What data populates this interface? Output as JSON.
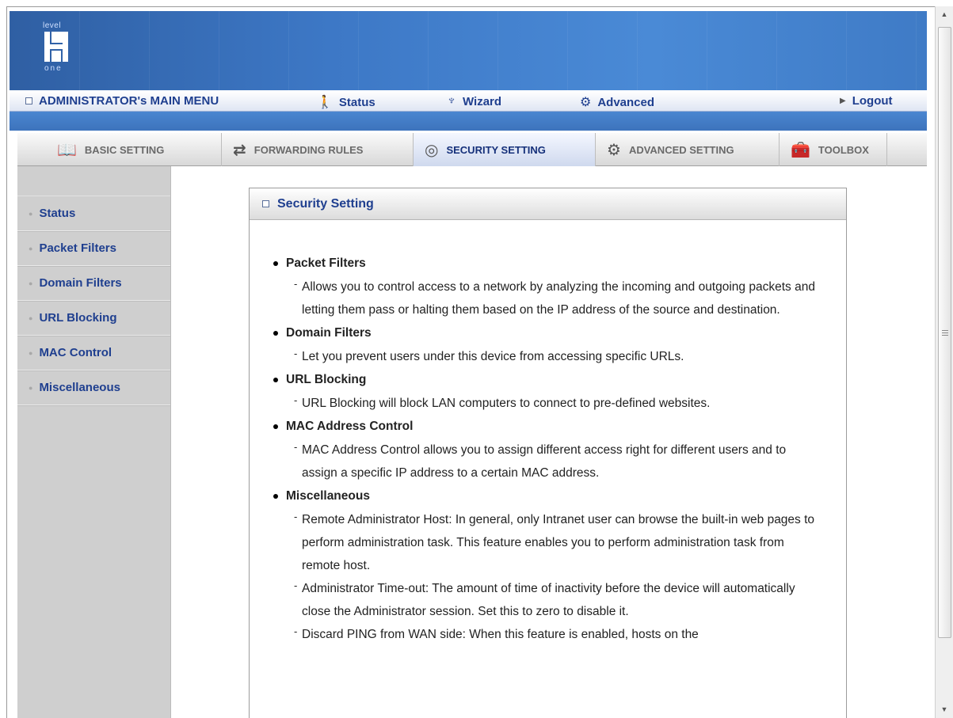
{
  "logo": {
    "top": "level",
    "bottom": "one"
  },
  "main_menu": {
    "title": "ADMINISTRATOR's MAIN MENU",
    "status": "Status",
    "wizard": "Wizard",
    "advanced": "Advanced",
    "logout": "Logout"
  },
  "tabs": [
    {
      "label": "BASIC SETTING",
      "icon": "book-icon"
    },
    {
      "label": "FORWARDING RULES",
      "icon": "arrows-icon"
    },
    {
      "label": "SECURITY SETTING",
      "icon": "lock-icon",
      "active": true
    },
    {
      "label": "ADVANCED SETTING",
      "icon": "gear-icon"
    },
    {
      "label": "TOOLBOX",
      "icon": "toolbox-icon"
    }
  ],
  "sidebar": {
    "items": [
      "Status",
      "Packet Filters",
      "Domain Filters",
      "URL Blocking",
      "MAC Control",
      "Miscellaneous"
    ]
  },
  "panel": {
    "title": "Security Setting",
    "sections": [
      {
        "title": "Packet Filters",
        "desc": [
          "Allows you to control access to a network by analyzing the incoming and outgoing packets and letting them pass or halting them based on the IP address of the source and destination."
        ]
      },
      {
        "title": "Domain Filters",
        "desc": [
          "Let you prevent users under this device from accessing specific URLs."
        ]
      },
      {
        "title": "URL Blocking",
        "desc": [
          "URL Blocking will block LAN computers to connect to pre-defined websites."
        ]
      },
      {
        "title": "MAC Address Control",
        "desc": [
          "MAC Address Control allows you to assign different access right for different users and to assign a specific IP address to a certain MAC address."
        ]
      },
      {
        "title": "Miscellaneous",
        "desc": [
          "Remote Administrator Host: In general, only Intranet user can browse the built-in web pages to perform administration task. This feature enables you to perform administration task from remote host.",
          "Administrator Time-out: The amount of time of inactivity before the device will automatically close the Administrator session. Set this to zero to disable it.",
          "Discard PING from WAN side: When this feature is enabled, hosts on the"
        ]
      }
    ]
  },
  "colors": {
    "accent": "#1f3f8f",
    "banner": "#3d78c6",
    "sidebar": "#cfcfcf"
  }
}
